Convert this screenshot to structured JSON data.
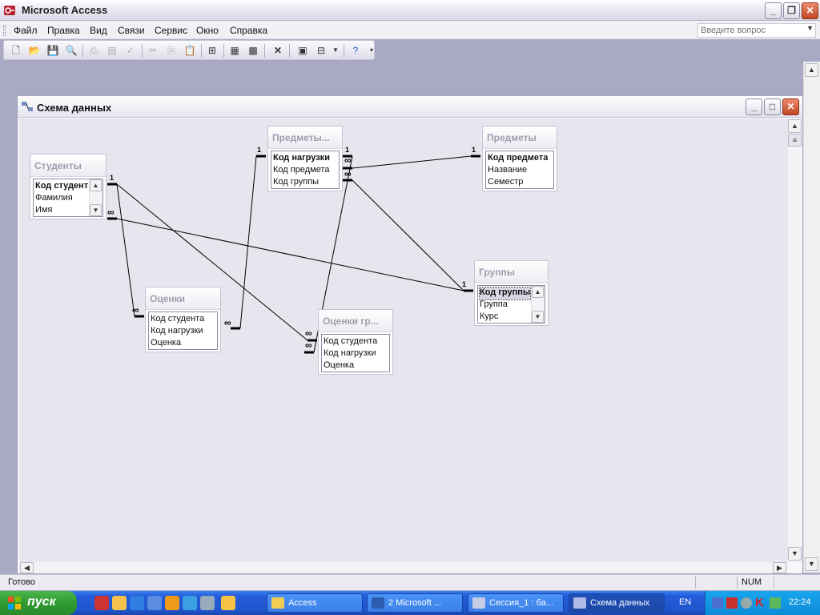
{
  "app": {
    "title": "Microsoft Access"
  },
  "menu": {
    "items": [
      {
        "label": "Файл"
      },
      {
        "label": "Правка"
      },
      {
        "label": "Вид"
      },
      {
        "label": "Связи"
      },
      {
        "label": "Сервис"
      },
      {
        "label": "Окно"
      },
      {
        "label": "Справка"
      }
    ],
    "help_placeholder": "Введите вопрос"
  },
  "relationships_window": {
    "title": "Схема данных",
    "tables": [
      {
        "name": "Студенты",
        "fields": [
          "Код студент",
          "Фамилия",
          "Имя"
        ],
        "primary_key": "Код студент"
      },
      {
        "name": "Предметы...",
        "fields": [
          "Код нагрузки",
          "Код предмета",
          "Код группы"
        ],
        "primary_key": "Код нагрузки"
      },
      {
        "name": "Предметы",
        "fields": [
          "Код предмета",
          "Название",
          "Семестр"
        ],
        "primary_key": "Код предмета"
      },
      {
        "name": "Группы",
        "fields": [
          "Код группы",
          "Группа",
          "Курс"
        ],
        "primary_key": "Код группы"
      },
      {
        "name": "Оценки",
        "fields": [
          "Код студента",
          "Код нагрузки",
          "Оценка"
        ]
      },
      {
        "name": "Оценки гр...",
        "fields": [
          "Код студента",
          "Код нагрузки",
          "Оценка"
        ]
      }
    ],
    "cardinality": {
      "one": "1",
      "many": "∞"
    }
  },
  "statusbar": {
    "text": "Готово",
    "num": "NUM"
  },
  "taskbar": {
    "start_label": "пуск",
    "tasks": [
      {
        "label": "Access"
      },
      {
        "label": "2 Microsoft ..."
      },
      {
        "label": "Сессия_1 : ба..."
      },
      {
        "label": "Схема данных"
      }
    ],
    "lang": "EN",
    "clock": "22:24"
  }
}
